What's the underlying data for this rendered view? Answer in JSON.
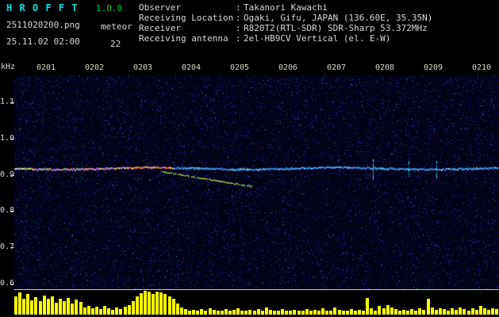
{
  "header": {
    "app_title": "H R O F F T",
    "version": "1.0.0",
    "filename": "2511020200.png",
    "mode": "meteor",
    "datetime": "25.11.02 02:00",
    "count": "22",
    "colon": ":",
    "info": [
      {
        "label": "Observer",
        "value": "Takanori Kawachi"
      },
      {
        "label": "Receiving Location",
        "value": "Ogaki, Gifu, JAPAN (136.60E, 35.35N)"
      },
      {
        "label": "Receiver",
        "value": "R820T2(RTL-SDR) SDR-Sharp 53.372MHz"
      },
      {
        "label": "Receiving antenna",
        "value": "2el-HB9CV Vertical (el. E-W)"
      }
    ]
  },
  "colors": {
    "title": "#00dddd",
    "version": "#00cc44",
    "text": "#d8d8d8",
    "bar": "#ffff00",
    "noise_base": "#000016",
    "carrier_cyan": "#44ccff"
  },
  "chart_data": {
    "type": "heatmap",
    "title": "",
    "ylabel": "kHz",
    "y_ticks": [
      "1.1",
      "1.0",
      "0.9",
      "0.8",
      "0.7",
      "0.6"
    ],
    "x_ticks": [
      "0201",
      "0202",
      "0203",
      "0204",
      "0205",
      "0206",
      "0207",
      "0208",
      "0209",
      "0210"
    ],
    "y_range_khz": [
      0.57,
      1.17
    ],
    "x_range": [
      "02:00",
      "02:10"
    ],
    "carrier_khz": 0.92,
    "carrier_drift": {
      "from_khz": 0.92,
      "to_khz": 0.87,
      "from_time": "02:03",
      "to_time": "02:05"
    },
    "vertical_blip_times": [
      "02:07.4",
      "02:08.1",
      "02:08.7"
    ],
    "amplitude_bars_percent": [
      78,
      92,
      68,
      85,
      60,
      72,
      55,
      80,
      65,
      75,
      50,
      68,
      58,
      70,
      45,
      62,
      52,
      30,
      38,
      25,
      32,
      22,
      35,
      28,
      20,
      30,
      24,
      34,
      40,
      55,
      75,
      90,
      100,
      95,
      88,
      98,
      92,
      85,
      78,
      65,
      45,
      30,
      22,
      18,
      20,
      16,
      22,
      18,
      25,
      20,
      15,
      18,
      22,
      16,
      20,
      28,
      18,
      15,
      20,
      16,
      22,
      18,
      30,
      20,
      16,
      18,
      24,
      18,
      15,
      20,
      16,
      18,
      22,
      16,
      20,
      18,
      25,
      18,
      15,
      30,
      20,
      16,
      18,
      22,
      16,
      20,
      18,
      70,
      25,
      18,
      35,
      28,
      40,
      30,
      22,
      18,
      20,
      16,
      22,
      18,
      25,
      20,
      65,
      30,
      20,
      28,
      22,
      18,
      25,
      20,
      30,
      22,
      18,
      28,
      20,
      35,
      25,
      20,
      28,
      22
    ]
  }
}
